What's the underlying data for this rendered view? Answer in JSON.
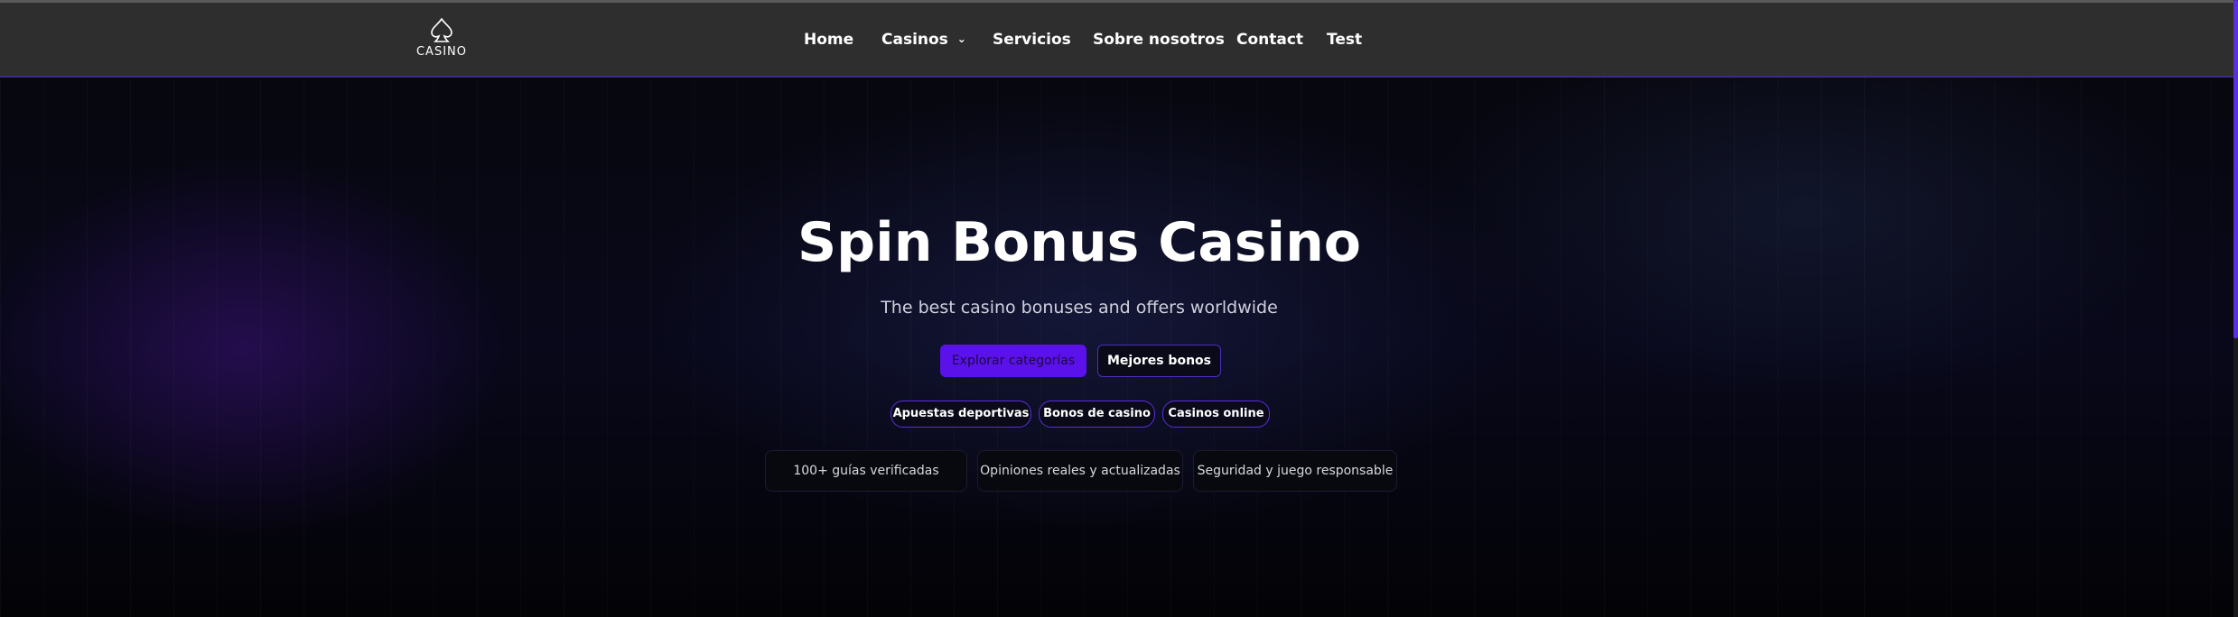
{
  "header": {
    "logo_text": "CASINO",
    "nav": [
      {
        "label": "Home"
      },
      {
        "label": "Casinos"
      },
      {
        "label": "Servicios"
      },
      {
        "label": "Sobre nosotros"
      },
      {
        "label": "Contact"
      },
      {
        "label": "Test"
      }
    ]
  },
  "hero": {
    "title": "Spin Bonus Casino",
    "subtitle": "The best casino bonuses and offers worldwide",
    "primary_button": "Explorar categorías",
    "secondary_button": "Mejores bonos",
    "pills": [
      "Apuestas deportivas",
      "Bonos de casino",
      "Casinos online"
    ],
    "features": [
      "100+ guías verificadas",
      "Opiniones reales y actualizadas",
      "Seguridad y juego responsable"
    ]
  },
  "colors": {
    "accent": "#5b12ea",
    "header_bg": "#2e2e2e",
    "pill_border": "#5a2ee0"
  }
}
